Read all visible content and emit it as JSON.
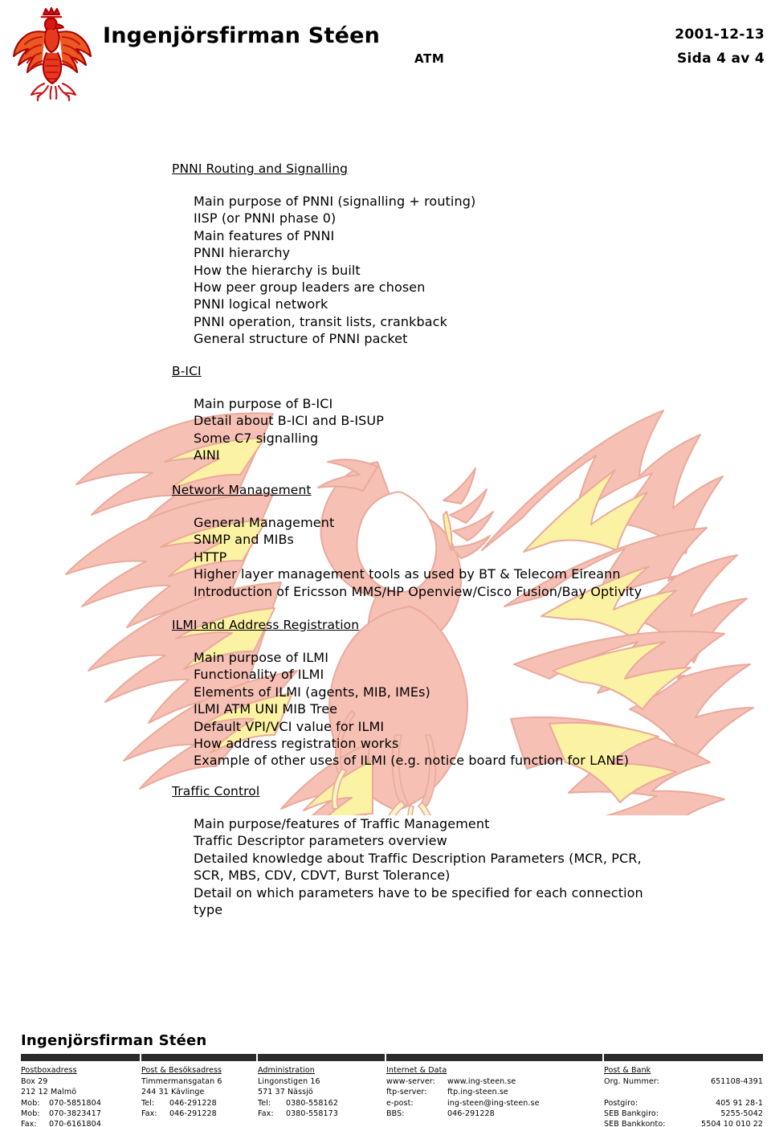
{
  "header": {
    "logo_icon": "heraldic-eagle-logo",
    "company_name": "Ingenjörsfirman Stéen",
    "doc_type": "ATM",
    "date": "2001-12-13",
    "page": "Sida 4 av 4"
  },
  "watermark": {
    "icon": "phoenix-watermark",
    "body_color": "#f6bfb4",
    "flame_color": "#fbf09a",
    "outline_color": "#e8a99c"
  },
  "content": {
    "sections": [
      {
        "heading": "PNNI Routing and Signalling",
        "items": [
          "Main purpose of PNNI (signalling + routing)",
          "IISP (or PNNI phase 0)",
          "Main features of PNNI",
          "PNNI hierarchy",
          "How the hierarchy is built",
          "How peer group leaders are chosen",
          "PNNI logical network",
          "PNNI operation, transit lists, crankback",
          "General structure of PNNI packet"
        ]
      },
      {
        "heading": "B-ICI",
        "items": [
          "Main purpose of B-ICI",
          "Detail about B-ICI and B-ISUP",
          "Some C7 signalling",
          "AINI"
        ]
      },
      {
        "heading": "Network Management",
        "items": [
          "General Management",
          "SNMP and MIBs",
          "HTTP",
          "Higher layer management tools as used by BT & Telecom Eireann",
          "Introduction of Ericsson MMS/HP Openview/Cisco Fusion/Bay Optivity"
        ]
      },
      {
        "heading": "ILMI and Address Registration",
        "items": [
          "Main purpose of ILMI",
          "Functionality of ILMI",
          "Elements of ILMI (agents, MIB, IMEs)",
          "ILMI ATM UNI MIB Tree",
          "Default VPI/VCI value for ILMI",
          "How address registration works",
          "Example of other uses of ILMI (e.g. notice board function for LANE)"
        ]
      },
      {
        "heading": "Traffic Control",
        "items": [
          "Main purpose/features of Traffic Management",
          "Traffic Descriptor parameters overview",
          "Detailed knowledge about Traffic Description Parameters (MCR, PCR,\nSCR, MBS, CDV, CDVT, Burst Tolerance)",
          "Detail on which parameters have to be specified for each connection\ntype"
        ]
      }
    ]
  },
  "footer": {
    "company_name": "Ingenjörsfirman Stéen",
    "columns": [
      {
        "heading": "Postboxadress",
        "rows": [
          {
            "key": "Box 29",
            "value": ""
          },
          {
            "key": "212 12 Malmö",
            "value": ""
          },
          {
            "key": "Mob:",
            "value": "070-5851804"
          },
          {
            "key": "Mob:",
            "value": "070-3823417"
          },
          {
            "key": "Fax:",
            "value": "070-6161804"
          }
        ]
      },
      {
        "heading": "Post & Besöksadress",
        "rows": [
          {
            "key": "Timmermansgatan 6",
            "value": ""
          },
          {
            "key": "244 31 Kävlinge",
            "value": ""
          },
          {
            "key": "Tel:",
            "value": "046-291228"
          },
          {
            "key": "Fax:",
            "value": "046-291228"
          }
        ]
      },
      {
        "heading": "Administration",
        "rows": [
          {
            "key": "Lingonstigen 16",
            "value": ""
          },
          {
            "key": "571 37 Nässjö",
            "value": ""
          },
          {
            "key": "Tel:",
            "value": "0380-558162"
          },
          {
            "key": "Fax:",
            "value": "0380-558173"
          }
        ]
      },
      {
        "heading": "Internet & Data",
        "rows": [
          {
            "key": "www-server:",
            "value": "www.ing-steen.se"
          },
          {
            "key": "ftp-server:",
            "value": "ftp.ing-steen.se"
          },
          {
            "key": "e-post:",
            "value": "ing-steen@ing-steen.se"
          },
          {
            "key": "BBS:",
            "value": "046-291228"
          }
        ]
      },
      {
        "heading": "Post & Bank",
        "rows": [
          {
            "key": "Org. Nummer:",
            "value": "651108-4391"
          },
          {
            "key": "",
            "value": ""
          },
          {
            "key": "Postgiro:",
            "value": "405 91 28-1"
          },
          {
            "key": "SEB Bankgiro:",
            "value": "5255-5042"
          },
          {
            "key": "SEB Bankkonto:",
            "value": "5504 10 010 22"
          }
        ]
      }
    ]
  }
}
